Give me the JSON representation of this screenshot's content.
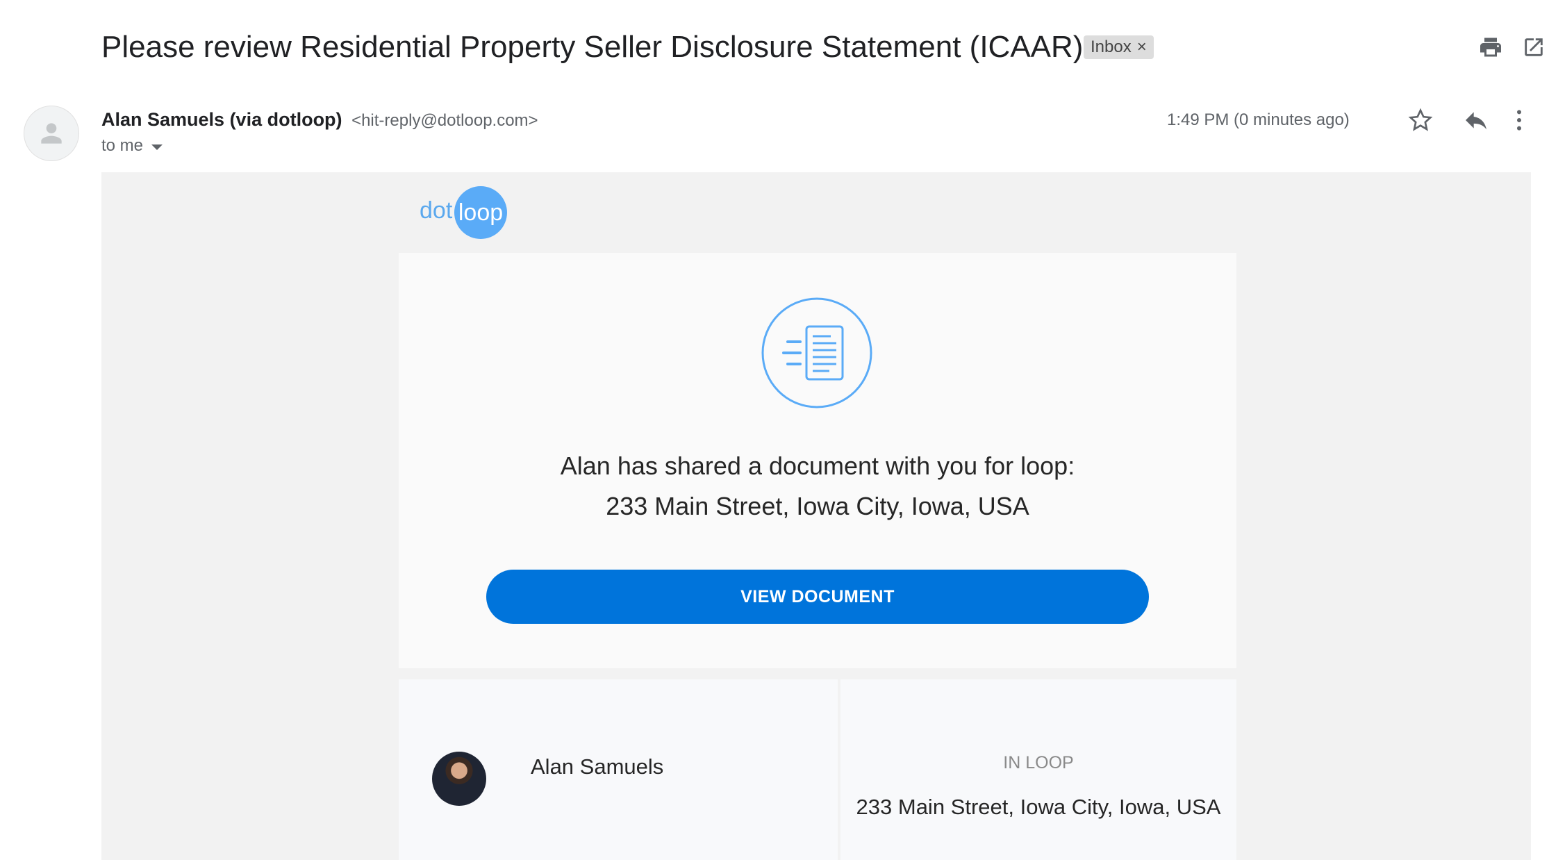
{
  "subject": "Please review Residential Property Seller Disclosure Statement (ICAAR)",
  "label_chip": {
    "text": "Inbox",
    "remove": "×"
  },
  "sender": {
    "name": "Alan Samuels (via dotloop)",
    "email": "<hit-reply@dotloop.com>",
    "to": "to me"
  },
  "timestamp": "1:49 PM (0 minutes ago)",
  "icons": {
    "print": "print-icon",
    "open_new_window": "open-in-new-icon",
    "star": "star-icon",
    "reply": "reply-icon",
    "more": "more-vert-icon",
    "avatar": "person-icon",
    "document": "document-icon"
  },
  "email": {
    "logo": {
      "dot": "dot",
      "loop": "loop"
    },
    "message_line1": "Alan has shared a document with you for loop:",
    "message_line2": "233 Main Street, Iowa City, Iowa, USA",
    "button_label": "VIEW DOCUMENT",
    "sharer_name": "Alan Samuels",
    "in_loop_label": "IN LOOP",
    "loop_address": "233 Main Street, Iowa City, Iowa, USA"
  },
  "colors": {
    "accent": "#0074db",
    "logo": "#5aabf7",
    "body_bg": "#f2f2f2"
  }
}
